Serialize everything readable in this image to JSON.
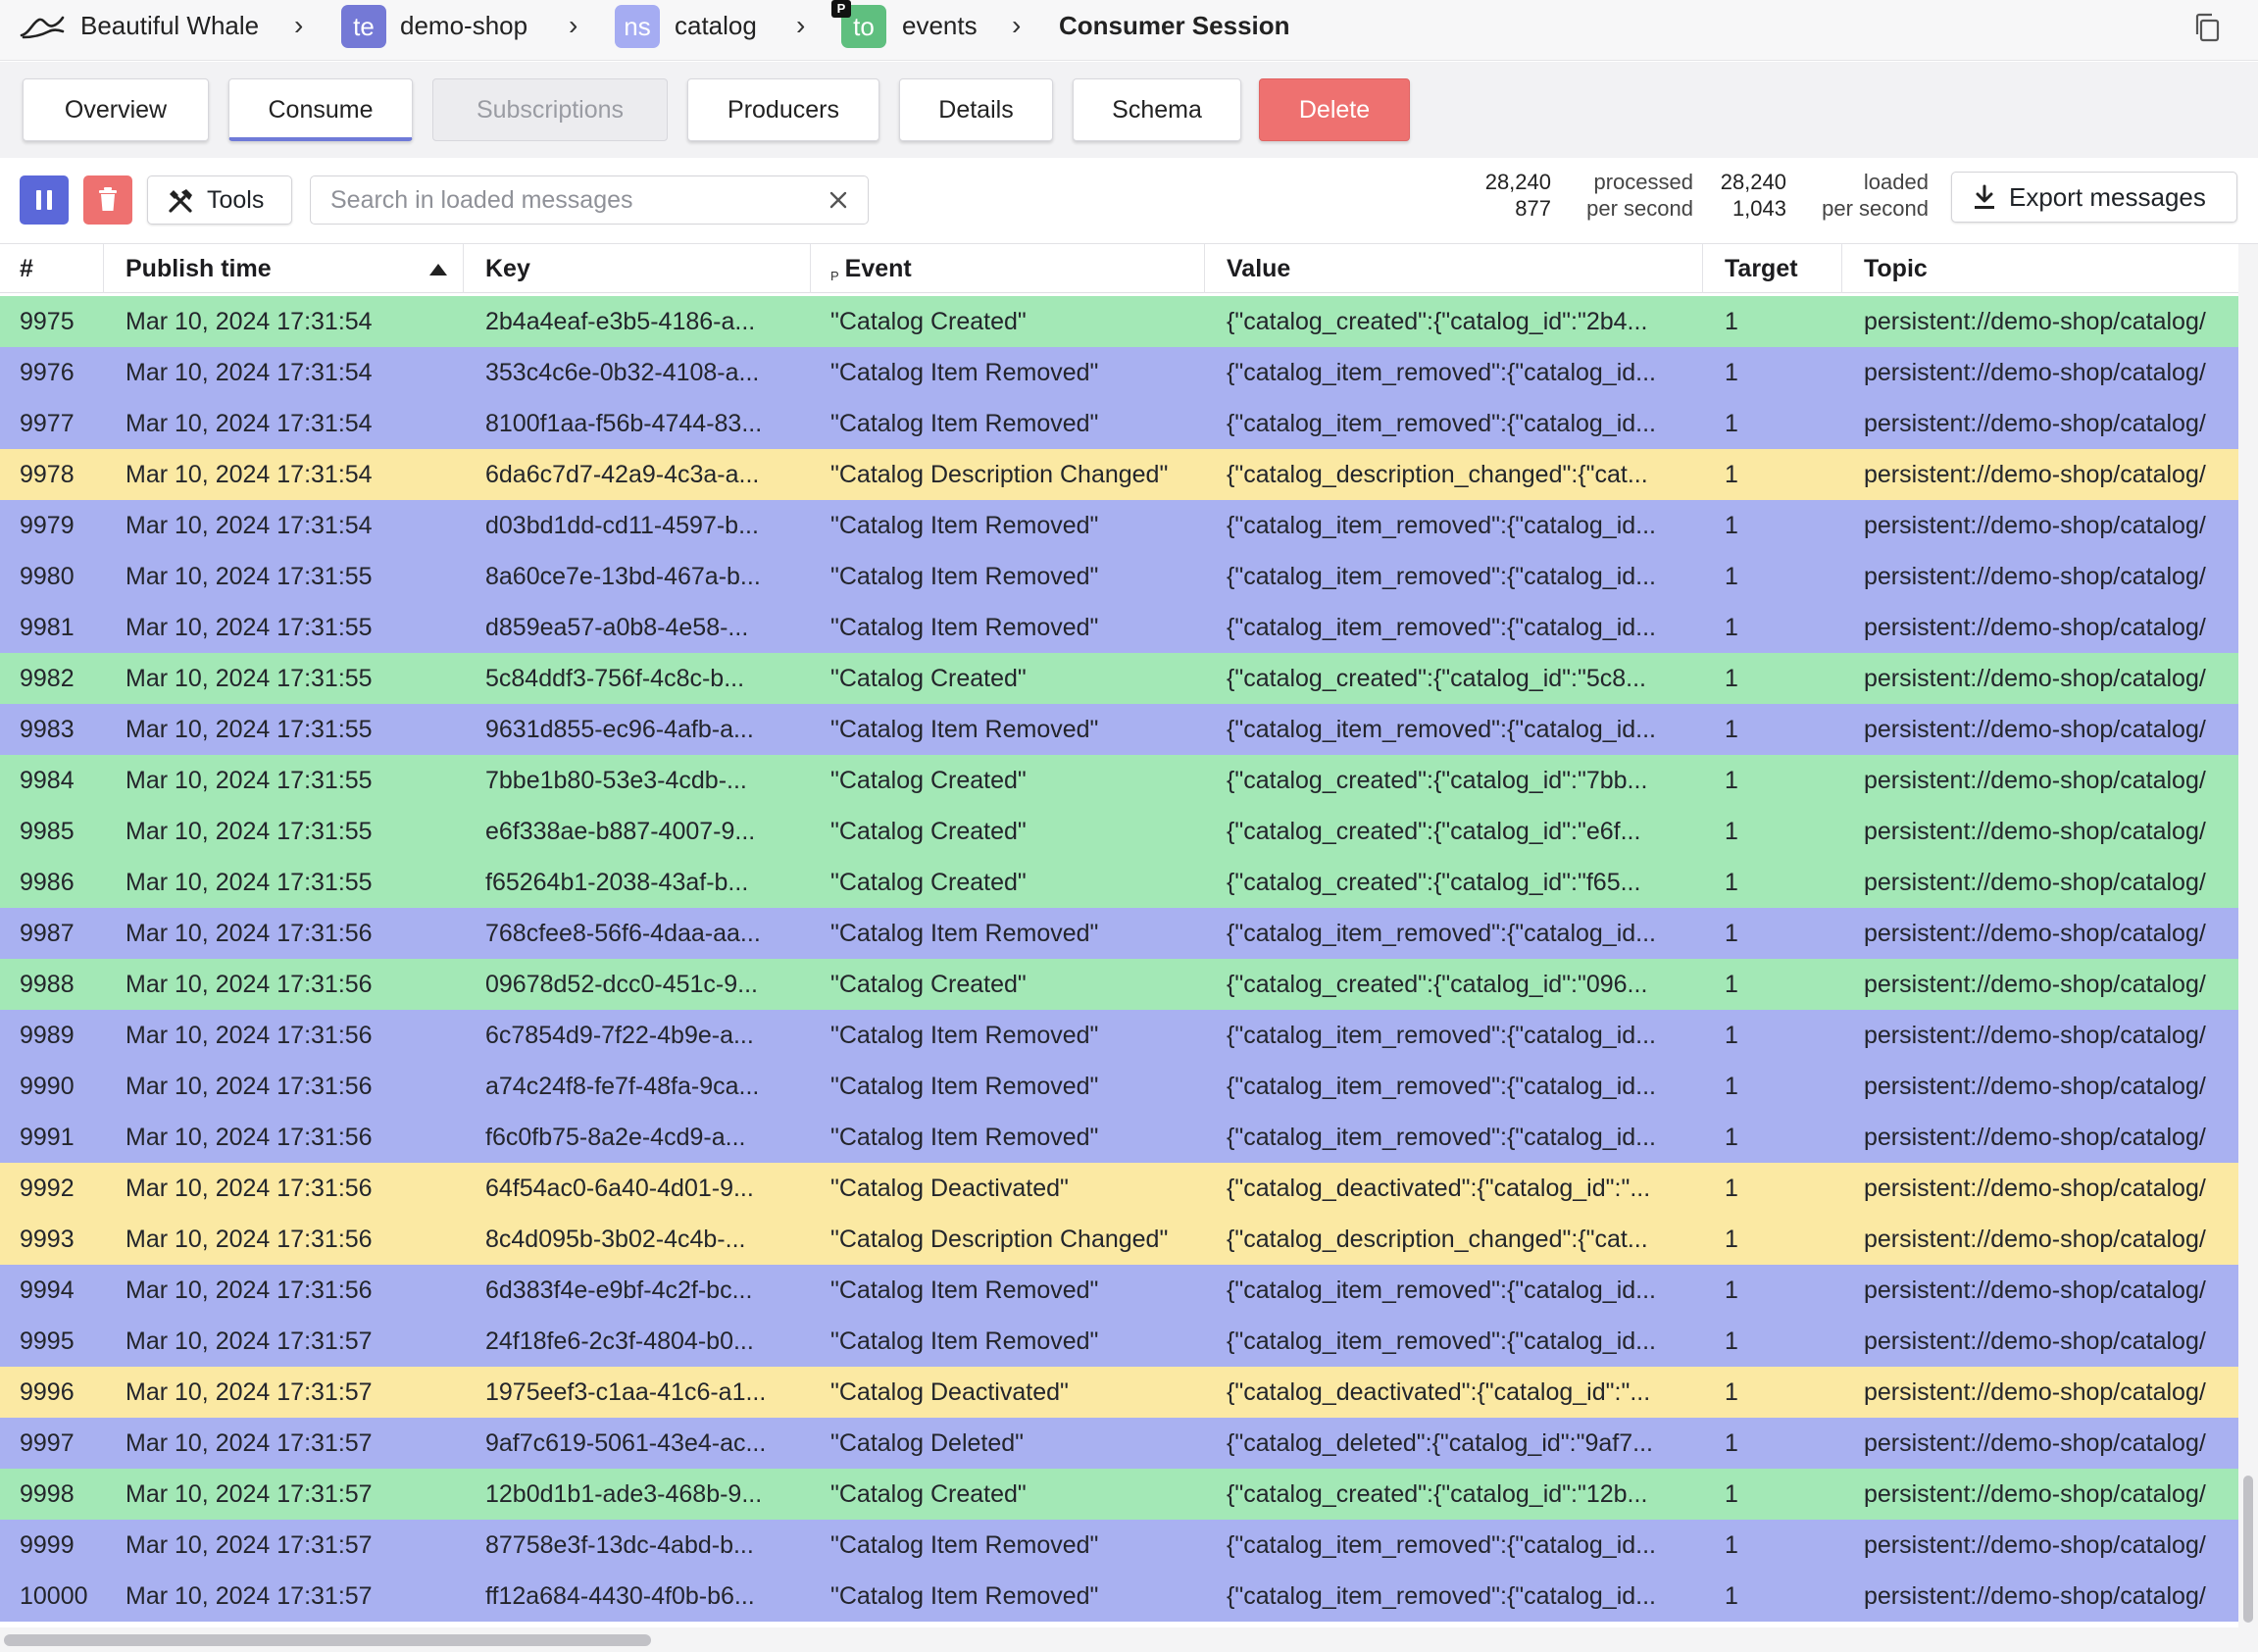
{
  "breadcrumb": {
    "instance": "Beautiful Whale",
    "tenant": {
      "badge": "te",
      "name": "demo-shop"
    },
    "namespace": {
      "badge": "ns",
      "name": "catalog"
    },
    "topic": {
      "badge": "to",
      "flag": "P",
      "name": "events"
    },
    "current": "Consumer Session"
  },
  "tabs": [
    {
      "label": "Overview"
    },
    {
      "label": "Consume"
    },
    {
      "label": "Subscriptions"
    },
    {
      "label": "Producers"
    },
    {
      "label": "Details"
    },
    {
      "label": "Schema"
    },
    {
      "label": "Delete"
    }
  ],
  "toolbar": {
    "tools_label": "Tools",
    "search_placeholder": "Search in loaded messages",
    "processed": {
      "total": "28,240",
      "rate": "877",
      "label": "processed",
      "rate_label": "per second"
    },
    "loaded": {
      "total": "28,240",
      "rate": "1,043",
      "label": "loaded",
      "rate_label": "per second"
    },
    "export_label": "Export messages"
  },
  "colors": {
    "created": "#a3e8b6",
    "removed": "#a9b1f1",
    "changed": "#fbe9a3",
    "delete": "#ee7170",
    "accent": "#5b68d9"
  },
  "table": {
    "columns": [
      {
        "label": "#"
      },
      {
        "label": "Publish time"
      },
      {
        "label": "Key"
      },
      {
        "label": "Event",
        "prefix": "P"
      },
      {
        "label": "Value"
      },
      {
        "label": "Target"
      },
      {
        "label": "Topic"
      }
    ],
    "rows": [
      {
        "num": "9975",
        "time": "Mar 10, 2024 17:31:54",
        "key": "2b4a4eaf-e3b5-4186-a...",
        "event": "\"Catalog Created\"",
        "value": "{\"catalog_created\":{\"catalog_id\":\"2b4...",
        "target": "1",
        "topic": "persistent://demo-shop/catalog/",
        "kind": "created"
      },
      {
        "num": "9976",
        "time": "Mar 10, 2024 17:31:54",
        "key": "353c4c6e-0b32-4108-a...",
        "event": "\"Catalog Item Removed\"",
        "value": "{\"catalog_item_removed\":{\"catalog_id...",
        "target": "1",
        "topic": "persistent://demo-shop/catalog/",
        "kind": "removed"
      },
      {
        "num": "9977",
        "time": "Mar 10, 2024 17:31:54",
        "key": "8100f1aa-f56b-4744-83...",
        "event": "\"Catalog Item Removed\"",
        "value": "{\"catalog_item_removed\":{\"catalog_id...",
        "target": "1",
        "topic": "persistent://demo-shop/catalog/",
        "kind": "removed"
      },
      {
        "num": "9978",
        "time": "Mar 10, 2024 17:31:54",
        "key": "6da6c7d7-42a9-4c3a-a...",
        "event": "\"Catalog Description Changed\"",
        "value": "{\"catalog_description_changed\":{\"cat...",
        "target": "1",
        "topic": "persistent://demo-shop/catalog/",
        "kind": "changed"
      },
      {
        "num": "9979",
        "time": "Mar 10, 2024 17:31:54",
        "key": "d03bd1dd-cd11-4597-b...",
        "event": "\"Catalog Item Removed\"",
        "value": "{\"catalog_item_removed\":{\"catalog_id...",
        "target": "1",
        "topic": "persistent://demo-shop/catalog/",
        "kind": "removed"
      },
      {
        "num": "9980",
        "time": "Mar 10, 2024 17:31:55",
        "key": "8a60ce7e-13bd-467a-b...",
        "event": "\"Catalog Item Removed\"",
        "value": "{\"catalog_item_removed\":{\"catalog_id...",
        "target": "1",
        "topic": "persistent://demo-shop/catalog/",
        "kind": "removed"
      },
      {
        "num": "9981",
        "time": "Mar 10, 2024 17:31:55",
        "key": "d859ea57-a0b8-4e58-...",
        "event": "\"Catalog Item Removed\"",
        "value": "{\"catalog_item_removed\":{\"catalog_id...",
        "target": "1",
        "topic": "persistent://demo-shop/catalog/",
        "kind": "removed"
      },
      {
        "num": "9982",
        "time": "Mar 10, 2024 17:31:55",
        "key": "5c84ddf3-756f-4c8c-b...",
        "event": "\"Catalog Created\"",
        "value": "{\"catalog_created\":{\"catalog_id\":\"5c8...",
        "target": "1",
        "topic": "persistent://demo-shop/catalog/",
        "kind": "created"
      },
      {
        "num": "9983",
        "time": "Mar 10, 2024 17:31:55",
        "key": "9631d855-ec96-4afb-a...",
        "event": "\"Catalog Item Removed\"",
        "value": "{\"catalog_item_removed\":{\"catalog_id...",
        "target": "1",
        "topic": "persistent://demo-shop/catalog/",
        "kind": "removed"
      },
      {
        "num": "9984",
        "time": "Mar 10, 2024 17:31:55",
        "key": "7bbe1b80-53e3-4cdb-...",
        "event": "\"Catalog Created\"",
        "value": "{\"catalog_created\":{\"catalog_id\":\"7bb...",
        "target": "1",
        "topic": "persistent://demo-shop/catalog/",
        "kind": "created"
      },
      {
        "num": "9985",
        "time": "Mar 10, 2024 17:31:55",
        "key": "e6f338ae-b887-4007-9...",
        "event": "\"Catalog Created\"",
        "value": "{\"catalog_created\":{\"catalog_id\":\"e6f...",
        "target": "1",
        "topic": "persistent://demo-shop/catalog/",
        "kind": "created"
      },
      {
        "num": "9986",
        "time": "Mar 10, 2024 17:31:55",
        "key": "f65264b1-2038-43af-b...",
        "event": "\"Catalog Created\"",
        "value": "{\"catalog_created\":{\"catalog_id\":\"f65...",
        "target": "1",
        "topic": "persistent://demo-shop/catalog/",
        "kind": "created"
      },
      {
        "num": "9987",
        "time": "Mar 10, 2024 17:31:56",
        "key": "768cfee8-56f6-4daa-aa...",
        "event": "\"Catalog Item Removed\"",
        "value": "{\"catalog_item_removed\":{\"catalog_id...",
        "target": "1",
        "topic": "persistent://demo-shop/catalog/",
        "kind": "removed"
      },
      {
        "num": "9988",
        "time": "Mar 10, 2024 17:31:56",
        "key": "09678d52-dcc0-451c-9...",
        "event": "\"Catalog Created\"",
        "value": "{\"catalog_created\":{\"catalog_id\":\"096...",
        "target": "1",
        "topic": "persistent://demo-shop/catalog/",
        "kind": "created"
      },
      {
        "num": "9989",
        "time": "Mar 10, 2024 17:31:56",
        "key": "6c7854d9-7f22-4b9e-a...",
        "event": "\"Catalog Item Removed\"",
        "value": "{\"catalog_item_removed\":{\"catalog_id...",
        "target": "1",
        "topic": "persistent://demo-shop/catalog/",
        "kind": "removed"
      },
      {
        "num": "9990",
        "time": "Mar 10, 2024 17:31:56",
        "key": "a74c24f8-fe7f-48fa-9ca...",
        "event": "\"Catalog Item Removed\"",
        "value": "{\"catalog_item_removed\":{\"catalog_id...",
        "target": "1",
        "topic": "persistent://demo-shop/catalog/",
        "kind": "removed"
      },
      {
        "num": "9991",
        "time": "Mar 10, 2024 17:31:56",
        "key": "f6c0fb75-8a2e-4cd9-a...",
        "event": "\"Catalog Item Removed\"",
        "value": "{\"catalog_item_removed\":{\"catalog_id...",
        "target": "1",
        "topic": "persistent://demo-shop/catalog/",
        "kind": "removed"
      },
      {
        "num": "9992",
        "time": "Mar 10, 2024 17:31:56",
        "key": "64f54ac0-6a40-4d01-9...",
        "event": "\"Catalog Deactivated\"",
        "value": "{\"catalog_deactivated\":{\"catalog_id\":\"...",
        "target": "1",
        "topic": "persistent://demo-shop/catalog/",
        "kind": "changed"
      },
      {
        "num": "9993",
        "time": "Mar 10, 2024 17:31:56",
        "key": "8c4d095b-3b02-4c4b-...",
        "event": "\"Catalog Description Changed\"",
        "value": "{\"catalog_description_changed\":{\"cat...",
        "target": "1",
        "topic": "persistent://demo-shop/catalog/",
        "kind": "changed"
      },
      {
        "num": "9994",
        "time": "Mar 10, 2024 17:31:56",
        "key": "6d383f4e-e9bf-4c2f-bc...",
        "event": "\"Catalog Item Removed\"",
        "value": "{\"catalog_item_removed\":{\"catalog_id...",
        "target": "1",
        "topic": "persistent://demo-shop/catalog/",
        "kind": "removed"
      },
      {
        "num": "9995",
        "time": "Mar 10, 2024 17:31:57",
        "key": "24f18fe6-2c3f-4804-b0...",
        "event": "\"Catalog Item Removed\"",
        "value": "{\"catalog_item_removed\":{\"catalog_id...",
        "target": "1",
        "topic": "persistent://demo-shop/catalog/",
        "kind": "removed"
      },
      {
        "num": "9996",
        "time": "Mar 10, 2024 17:31:57",
        "key": "1975eef3-c1aa-41c6-a1...",
        "event": "\"Catalog Deactivated\"",
        "value": "{\"catalog_deactivated\":{\"catalog_id\":\"...",
        "target": "1",
        "topic": "persistent://demo-shop/catalog/",
        "kind": "changed"
      },
      {
        "num": "9997",
        "time": "Mar 10, 2024 17:31:57",
        "key": "9af7c619-5061-43e4-ac...",
        "event": "\"Catalog Deleted\"",
        "value": "{\"catalog_deleted\":{\"catalog_id\":\"9af7...",
        "target": "1",
        "topic": "persistent://demo-shop/catalog/",
        "kind": "removed"
      },
      {
        "num": "9998",
        "time": "Mar 10, 2024 17:31:57",
        "key": "12b0d1b1-ade3-468b-9...",
        "event": "\"Catalog Created\"",
        "value": "{\"catalog_created\":{\"catalog_id\":\"12b...",
        "target": "1",
        "topic": "persistent://demo-shop/catalog/",
        "kind": "created"
      },
      {
        "num": "9999",
        "time": "Mar 10, 2024 17:31:57",
        "key": "87758e3f-13dc-4abd-b...",
        "event": "\"Catalog Item Removed\"",
        "value": "{\"catalog_item_removed\":{\"catalog_id...",
        "target": "1",
        "topic": "persistent://demo-shop/catalog/",
        "kind": "removed"
      },
      {
        "num": "10000",
        "time": "Mar 10, 2024 17:31:57",
        "key": "ff12a684-4430-4f0b-b6...",
        "event": "\"Catalog Item Removed\"",
        "value": "{\"catalog_item_removed\":{\"catalog_id...",
        "target": "1",
        "topic": "persistent://demo-shop/catalog/",
        "kind": "removed"
      }
    ]
  }
}
